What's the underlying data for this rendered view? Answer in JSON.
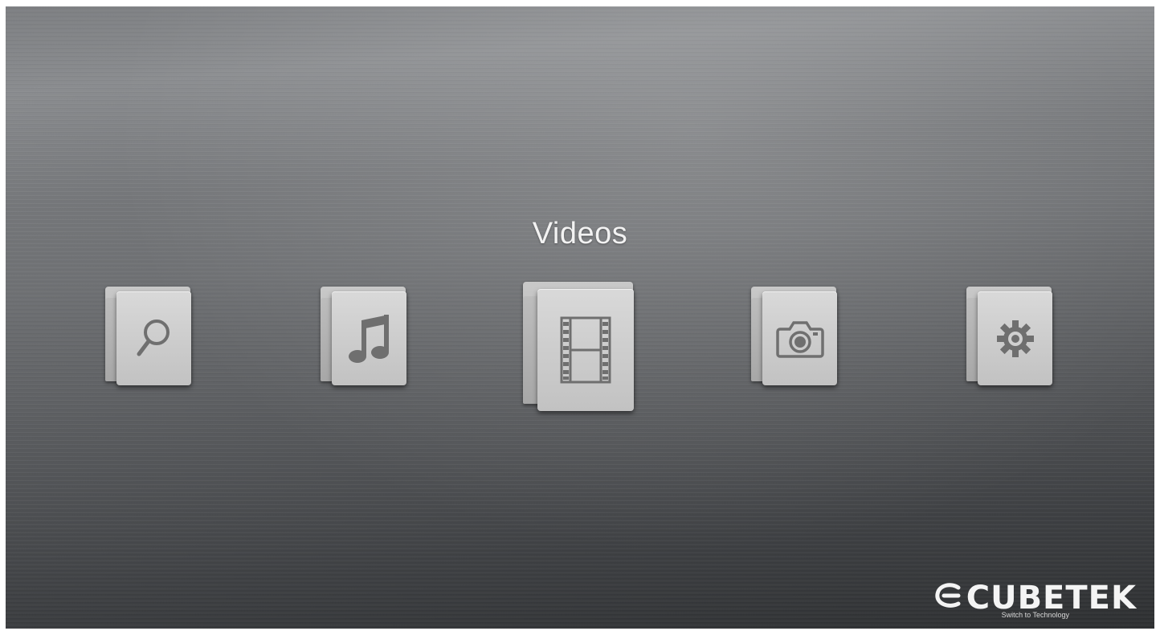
{
  "title": "Videos",
  "menu": {
    "items": [
      {
        "key": "search",
        "icon": "search-icon",
        "label": "Search",
        "selected": false
      },
      {
        "key": "music",
        "icon": "music-note-icon",
        "label": "Music",
        "selected": false
      },
      {
        "key": "videos",
        "icon": "film-strip-icon",
        "label": "Videos",
        "selected": true
      },
      {
        "key": "photos",
        "icon": "camera-icon",
        "label": "Photos",
        "selected": false
      },
      {
        "key": "settings",
        "icon": "gear-icon",
        "label": "Settings",
        "selected": false
      }
    ]
  },
  "brand": {
    "name": "CUBETEK",
    "tagline": "Switch to Technology"
  },
  "colors": {
    "folder_face": "#d0d0d0",
    "icon_glyph": "#6f6f6f",
    "title_text": "#f2f2f2"
  }
}
